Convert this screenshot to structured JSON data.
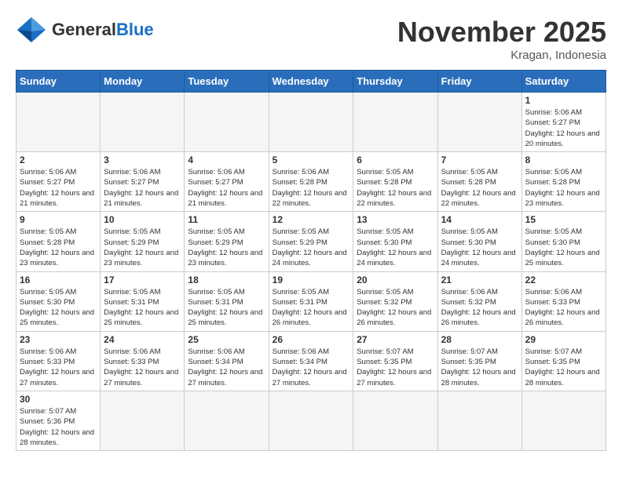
{
  "logo": {
    "text_general": "General",
    "text_blue": "Blue"
  },
  "title": "November 2025",
  "subtitle": "Kragan, Indonesia",
  "days_of_week": [
    "Sunday",
    "Monday",
    "Tuesday",
    "Wednesday",
    "Thursday",
    "Friday",
    "Saturday"
  ],
  "weeks": [
    [
      {
        "day": "",
        "info": ""
      },
      {
        "day": "",
        "info": ""
      },
      {
        "day": "",
        "info": ""
      },
      {
        "day": "",
        "info": ""
      },
      {
        "day": "",
        "info": ""
      },
      {
        "day": "",
        "info": ""
      },
      {
        "day": "1",
        "info": "Sunrise: 5:06 AM\nSunset: 5:27 PM\nDaylight: 12 hours and 20 minutes."
      }
    ],
    [
      {
        "day": "2",
        "info": "Sunrise: 5:06 AM\nSunset: 5:27 PM\nDaylight: 12 hours and 21 minutes."
      },
      {
        "day": "3",
        "info": "Sunrise: 5:06 AM\nSunset: 5:27 PM\nDaylight: 12 hours and 21 minutes."
      },
      {
        "day": "4",
        "info": "Sunrise: 5:06 AM\nSunset: 5:27 PM\nDaylight: 12 hours and 21 minutes."
      },
      {
        "day": "5",
        "info": "Sunrise: 5:06 AM\nSunset: 5:28 PM\nDaylight: 12 hours and 22 minutes."
      },
      {
        "day": "6",
        "info": "Sunrise: 5:05 AM\nSunset: 5:28 PM\nDaylight: 12 hours and 22 minutes."
      },
      {
        "day": "7",
        "info": "Sunrise: 5:05 AM\nSunset: 5:28 PM\nDaylight: 12 hours and 22 minutes."
      },
      {
        "day": "8",
        "info": "Sunrise: 5:05 AM\nSunset: 5:28 PM\nDaylight: 12 hours and 23 minutes."
      }
    ],
    [
      {
        "day": "9",
        "info": "Sunrise: 5:05 AM\nSunset: 5:28 PM\nDaylight: 12 hours and 23 minutes."
      },
      {
        "day": "10",
        "info": "Sunrise: 5:05 AM\nSunset: 5:29 PM\nDaylight: 12 hours and 23 minutes."
      },
      {
        "day": "11",
        "info": "Sunrise: 5:05 AM\nSunset: 5:29 PM\nDaylight: 12 hours and 23 minutes."
      },
      {
        "day": "12",
        "info": "Sunrise: 5:05 AM\nSunset: 5:29 PM\nDaylight: 12 hours and 24 minutes."
      },
      {
        "day": "13",
        "info": "Sunrise: 5:05 AM\nSunset: 5:30 PM\nDaylight: 12 hours and 24 minutes."
      },
      {
        "day": "14",
        "info": "Sunrise: 5:05 AM\nSunset: 5:30 PM\nDaylight: 12 hours and 24 minutes."
      },
      {
        "day": "15",
        "info": "Sunrise: 5:05 AM\nSunset: 5:30 PM\nDaylight: 12 hours and 25 minutes."
      }
    ],
    [
      {
        "day": "16",
        "info": "Sunrise: 5:05 AM\nSunset: 5:30 PM\nDaylight: 12 hours and 25 minutes."
      },
      {
        "day": "17",
        "info": "Sunrise: 5:05 AM\nSunset: 5:31 PM\nDaylight: 12 hours and 25 minutes."
      },
      {
        "day": "18",
        "info": "Sunrise: 5:05 AM\nSunset: 5:31 PM\nDaylight: 12 hours and 25 minutes."
      },
      {
        "day": "19",
        "info": "Sunrise: 5:05 AM\nSunset: 5:31 PM\nDaylight: 12 hours and 26 minutes."
      },
      {
        "day": "20",
        "info": "Sunrise: 5:05 AM\nSunset: 5:32 PM\nDaylight: 12 hours and 26 minutes."
      },
      {
        "day": "21",
        "info": "Sunrise: 5:06 AM\nSunset: 5:32 PM\nDaylight: 12 hours and 26 minutes."
      },
      {
        "day": "22",
        "info": "Sunrise: 5:06 AM\nSunset: 5:33 PM\nDaylight: 12 hours and 26 minutes."
      }
    ],
    [
      {
        "day": "23",
        "info": "Sunrise: 5:06 AM\nSunset: 5:33 PM\nDaylight: 12 hours and 27 minutes."
      },
      {
        "day": "24",
        "info": "Sunrise: 5:06 AM\nSunset: 5:33 PM\nDaylight: 12 hours and 27 minutes."
      },
      {
        "day": "25",
        "info": "Sunrise: 5:06 AM\nSunset: 5:34 PM\nDaylight: 12 hours and 27 minutes."
      },
      {
        "day": "26",
        "info": "Sunrise: 5:06 AM\nSunset: 5:34 PM\nDaylight: 12 hours and 27 minutes."
      },
      {
        "day": "27",
        "info": "Sunrise: 5:07 AM\nSunset: 5:35 PM\nDaylight: 12 hours and 27 minutes."
      },
      {
        "day": "28",
        "info": "Sunrise: 5:07 AM\nSunset: 5:35 PM\nDaylight: 12 hours and 28 minutes."
      },
      {
        "day": "29",
        "info": "Sunrise: 5:07 AM\nSunset: 5:35 PM\nDaylight: 12 hours and 28 minutes."
      }
    ],
    [
      {
        "day": "30",
        "info": "Sunrise: 5:07 AM\nSunset: 5:36 PM\nDaylight: 12 hours and 28 minutes."
      },
      {
        "day": "",
        "info": ""
      },
      {
        "day": "",
        "info": ""
      },
      {
        "day": "",
        "info": ""
      },
      {
        "day": "",
        "info": ""
      },
      {
        "day": "",
        "info": ""
      },
      {
        "day": "",
        "info": ""
      }
    ]
  ]
}
